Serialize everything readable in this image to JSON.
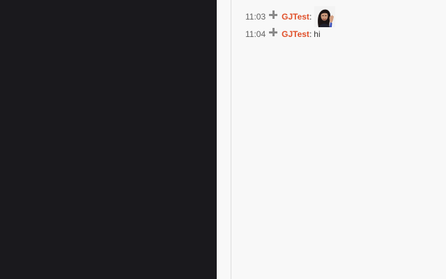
{
  "messages": [
    {
      "time": "11:03",
      "user": "GJTest",
      "colon": ":",
      "text": "",
      "attachment_icon": "plus-icon",
      "sticker": "woman-waving-sticker"
    },
    {
      "time": "11:04",
      "user": "GJTest",
      "colon": ":",
      "text": "hi",
      "attachment_icon": "plus-icon"
    }
  ],
  "colors": {
    "left_pane": "#1a191d",
    "chat_background": "#f8f8f8",
    "username": "#e0502a",
    "timestamp": "#606060"
  }
}
